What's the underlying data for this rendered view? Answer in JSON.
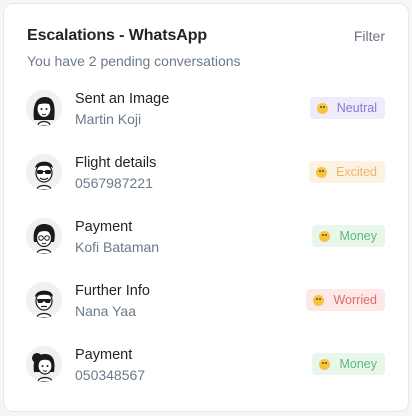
{
  "header": {
    "title": "Escalations - WhatsApp",
    "filter_label": "Filter",
    "subtitle": "You have 2 pending conversations"
  },
  "conversations": [
    {
      "title": "Sent an Image",
      "subtitle": "Martin Koji",
      "avatar_icon": "avatar-long-hair-icon",
      "badge": {
        "label": "Neutral",
        "emoji": "neutral-face-icon",
        "bg": "#eeebfb",
        "fg": "#8a78d6",
        "emoji_color": "#f5c542"
      }
    },
    {
      "title": "Flight details",
      "subtitle": "0567987221",
      "avatar_icon": "avatar-sunglasses-icon",
      "badge": {
        "label": "Excited",
        "emoji": "star-struck-face-icon",
        "bg": "#fdf1e3",
        "fg": "#f0b36a",
        "emoji_color": "#f5c542"
      }
    },
    {
      "title": "Payment",
      "subtitle": "Kofi Bataman",
      "avatar_icon": "avatar-glasses-icon",
      "badge": {
        "label": "Money",
        "emoji": "money-mouth-face-icon",
        "bg": "#e8f6ec",
        "fg": "#5cb87a",
        "emoji_color": "#f5c542"
      }
    },
    {
      "title": "Further Info",
      "subtitle": "Nana Yaa",
      "avatar_icon": "avatar-shades-icon",
      "badge": {
        "label": "Worried",
        "emoji": "anxious-face-icon",
        "bg": "#fde8e8",
        "fg": "#e06b6b",
        "emoji_color": "#f5c542"
      }
    },
    {
      "title": "Payment",
      "subtitle": "050348567",
      "avatar_icon": "avatar-bun-hair-icon",
      "badge": {
        "label": "Money",
        "emoji": "money-mouth-face-icon",
        "bg": "#e8f6ec",
        "fg": "#5cb87a",
        "emoji_color": "#f5c542"
      }
    }
  ]
}
